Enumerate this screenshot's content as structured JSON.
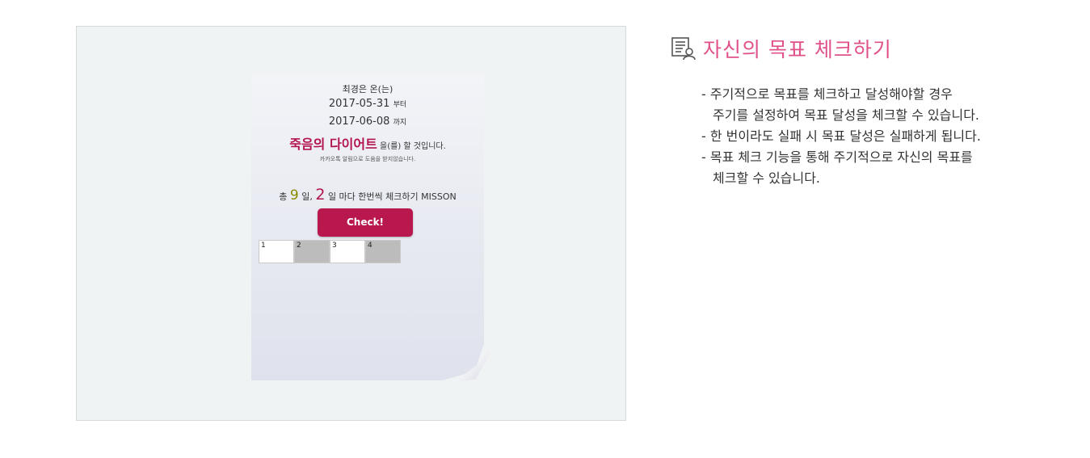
{
  "preview": {
    "user_line": "최경은 온(는)",
    "start_date": "2017-05-31",
    "start_suffix": "부터",
    "end_date": "2017-06-08",
    "end_suffix": "까지",
    "diet_title": "죽음의 다이어트",
    "diet_suffix": "을(를) 할 것입니다.",
    "kakao_notice": "카카오톡 알림으로 도움을 받지않습니다.",
    "mission": {
      "prefix": "총",
      "total_days": "9",
      "days_sep": "일,",
      "interval": "2",
      "suffix": "일 마다 한번씩 체크하기 MISSON"
    },
    "check_button": "Check!",
    "cells": [
      {
        "label": "1",
        "checked": false
      },
      {
        "label": "2",
        "checked": true
      },
      {
        "label": "3",
        "checked": false
      },
      {
        "label": "4",
        "checked": true
      }
    ]
  },
  "section": {
    "icon": "checklist-user-icon",
    "title": "자신의 목표 체크하기",
    "title_color": "#e0518a",
    "accent_color": "#b9184e",
    "lines": [
      "- 주기적으로 목표를 체크하고 달성해야할 경우",
      "주기를 설정하여 목표 달성을 체크할 수 있습니다.",
      "- 한 번이라도 실패 시 목표 달성은 실패하게 됩니다.",
      "- 목표 체크 기능을 통해 주기적으로 자신의 목표를",
      "체크할 수 있습니다."
    ]
  }
}
